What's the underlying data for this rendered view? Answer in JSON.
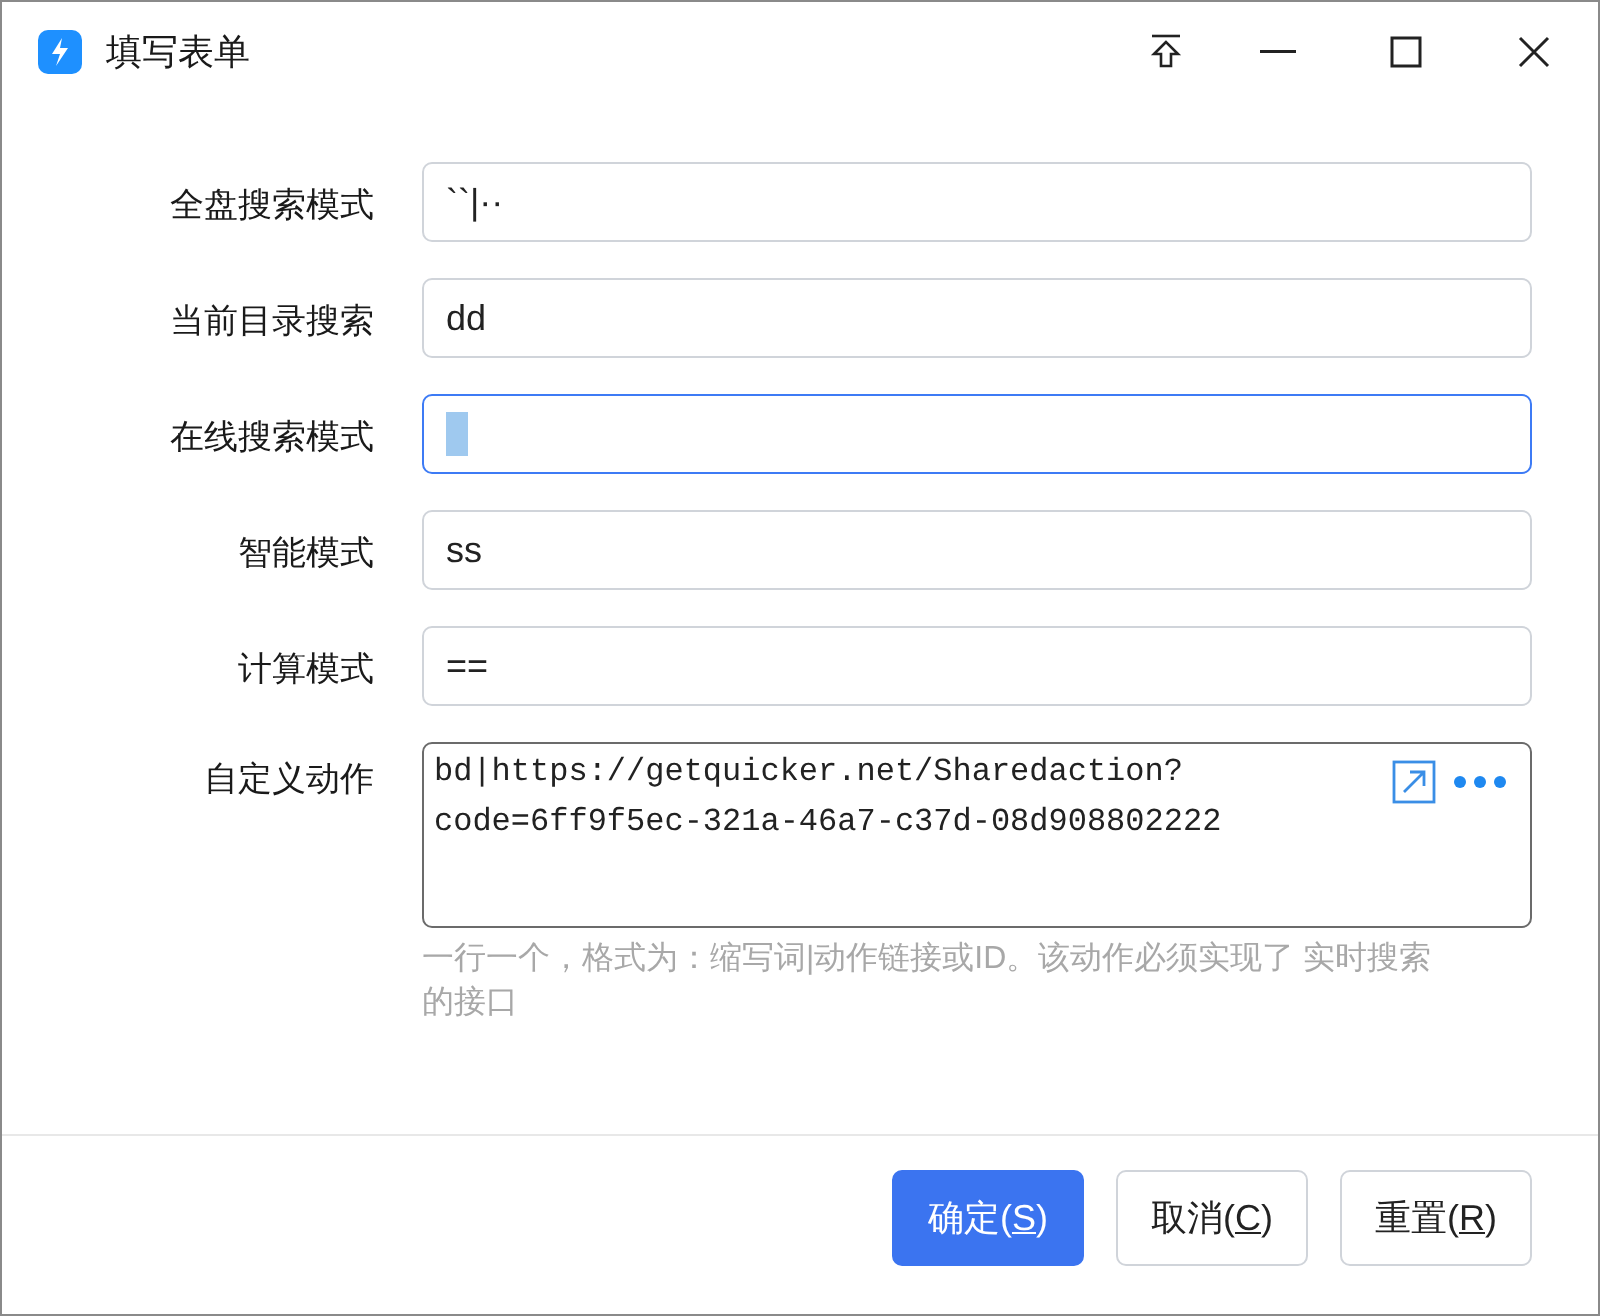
{
  "window": {
    "title": "填写表单"
  },
  "fields": [
    {
      "label": "全盘搜索模式",
      "kind": "input",
      "value": "``|··",
      "focused": false
    },
    {
      "label": "当前目录搜索",
      "kind": "input",
      "value": "dd",
      "focused": false
    },
    {
      "label": "在线搜索模式",
      "kind": "input",
      "focused": true
    },
    {
      "label": "智能模式",
      "kind": "input",
      "value": "ss",
      "focused": false
    },
    {
      "label": "计算模式",
      "kind": "input",
      "value": "==",
      "focused": false
    },
    {
      "label": "自定义动作",
      "kind": "textarea",
      "value": "bd|https://getquicker.net/Sharedaction?code=6ff9f5ec-321a-46a7-c37d-08d908802222",
      "focused": false,
      "hint": "一行一个，格式为：缩写词|动作链接或ID。该动作必须实现了 实时搜索的接口"
    }
  ],
  "buttons": [
    {
      "label_parts": [
        "确定(",
        "S",
        ")"
      ],
      "kind": "primary"
    },
    {
      "label_parts": [
        "取消(",
        "C",
        ")"
      ],
      "kind": "default"
    },
    {
      "label_parts": [
        "重置(",
        "R",
        ")"
      ],
      "kind": "default"
    }
  ]
}
